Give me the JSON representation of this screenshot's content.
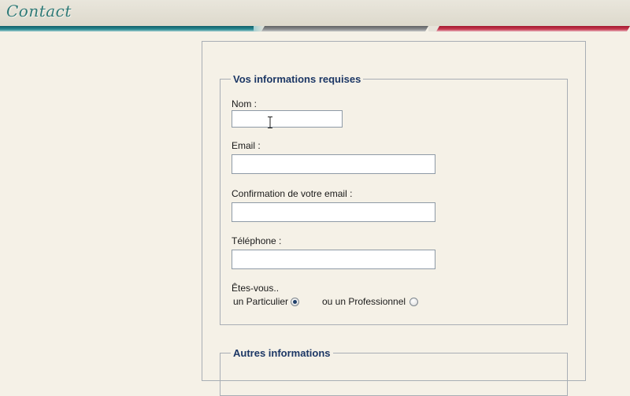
{
  "header": {
    "logo_text": "Contact"
  },
  "form": {
    "required_section": {
      "legend": "Vos informations requises",
      "fields": {
        "nom": {
          "label": "Nom :",
          "value": ""
        },
        "email": {
          "label": "Email :",
          "value": ""
        },
        "email_confirm": {
          "label": "Confirmation de votre email :",
          "value": ""
        },
        "telephone": {
          "label": "Téléphone :",
          "value": ""
        }
      },
      "type_question": "Êtes-vous..",
      "options": {
        "particulier": {
          "label": "un Particulier",
          "checked": true
        },
        "professionnel": {
          "label": "ou un Professionnel",
          "checked": false
        }
      }
    },
    "other_section": {
      "legend": "Autres informations"
    }
  },
  "colors": {
    "background": "#f5f1e7",
    "legend_text": "#1c3765",
    "stripe_teal": "#0f5e68",
    "stripe_grey": "#5f6163",
    "stripe_red": "#a3162e",
    "logo": "#2f7a77"
  }
}
